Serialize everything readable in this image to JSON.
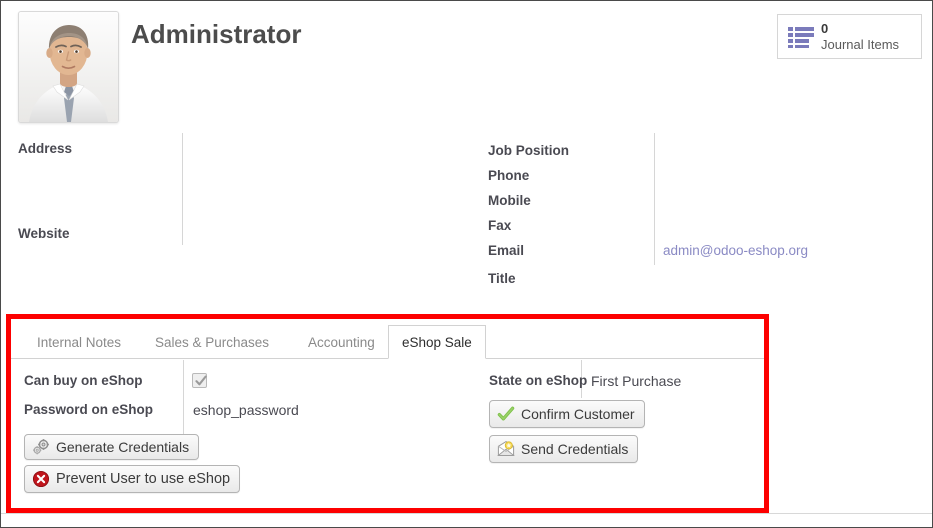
{
  "header": {
    "title": "Administrator",
    "avatar_alt": "user-photo",
    "stat_button": {
      "icon": "list-icon",
      "value": "0",
      "label": "Journal Items"
    }
  },
  "fields": {
    "left": [
      {
        "label": "Address",
        "value": ""
      },
      {
        "label": "Website",
        "value": ""
      }
    ],
    "right": [
      {
        "label": "Job Position",
        "value": ""
      },
      {
        "label": "Phone",
        "value": ""
      },
      {
        "label": "Mobile",
        "value": ""
      },
      {
        "label": "Fax",
        "value": ""
      },
      {
        "label": "Email",
        "value": "admin@odoo-eshop.org"
      },
      {
        "label": "Title",
        "value": ""
      }
    ]
  },
  "notebook": {
    "tabs": [
      {
        "label": "Internal Notes",
        "active": false
      },
      {
        "label": "Sales & Purchases",
        "active": false
      },
      {
        "label": "Accounting",
        "active": false
      },
      {
        "label": "eShop Sale",
        "active": true
      }
    ],
    "eshop_sale": {
      "can_buy_label": "Can buy on eShop",
      "can_buy_checked": true,
      "password_label": "Password on eShop",
      "password_value": "eshop_password",
      "state_label": "State on eShop",
      "state_value": "First Purchase",
      "buttons": {
        "generate_credentials": "Generate Credentials",
        "prevent_user": "Prevent User to use eShop",
        "confirm_customer": "Confirm Customer",
        "send_credentials": "Send Credentials"
      },
      "icons": {
        "generate_credentials": "gears-icon",
        "prevent_user": "red-x-circle-icon",
        "confirm_customer": "green-check-icon",
        "send_credentials": "envelope-icon"
      }
    }
  },
  "colors": {
    "highlight_box": "#fd0000",
    "link": "#8a8ac4",
    "label_text": "#4a4a52",
    "title_text": "#4c4c4c",
    "stat_icon": "#7b7bbb"
  }
}
